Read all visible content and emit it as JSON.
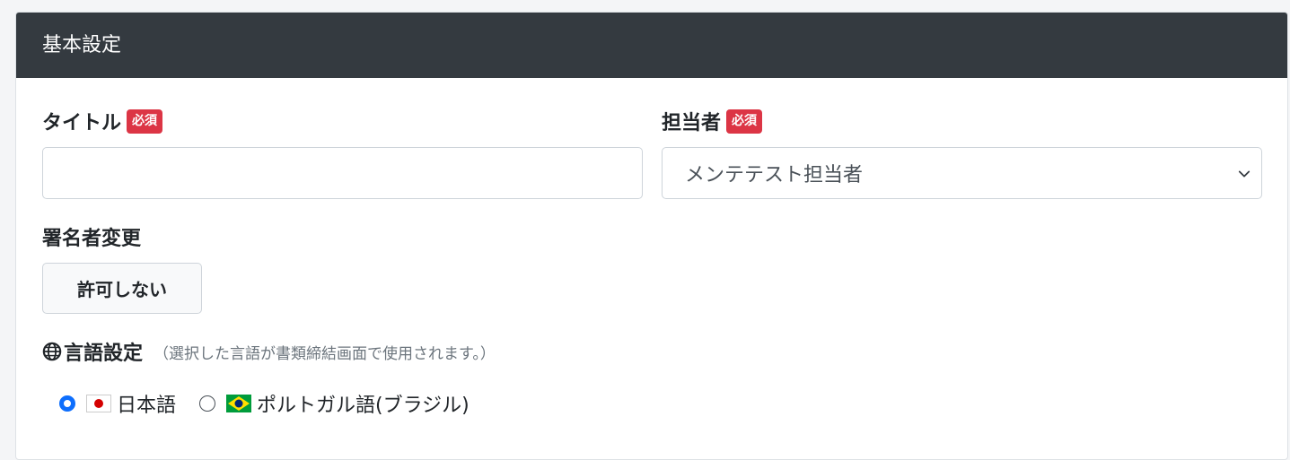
{
  "section": {
    "title": "基本設定"
  },
  "title_field": {
    "label": "タイトル",
    "required_badge": "必須",
    "value": "",
    "placeholder": ""
  },
  "assignee_field": {
    "label": "担当者",
    "required_badge": "必須",
    "selected": "メンテテスト担当者"
  },
  "signer_change": {
    "label": "署名者変更",
    "button_label": "許可しない"
  },
  "language": {
    "icon": "globe-icon",
    "label": "言語設定",
    "note": "（選択した言語が書類締結画面で使用されます。）",
    "options": [
      {
        "label": "日本語",
        "flag": "japan-flag-icon",
        "checked": true
      },
      {
        "label": "ポルトガル語(ブラジル)",
        "flag": "brazil-flag-icon",
        "checked": false
      }
    ]
  },
  "colors": {
    "header_bg": "#343a40",
    "badge_bg": "#dc3545",
    "radio_accent": "#0d6efd"
  }
}
